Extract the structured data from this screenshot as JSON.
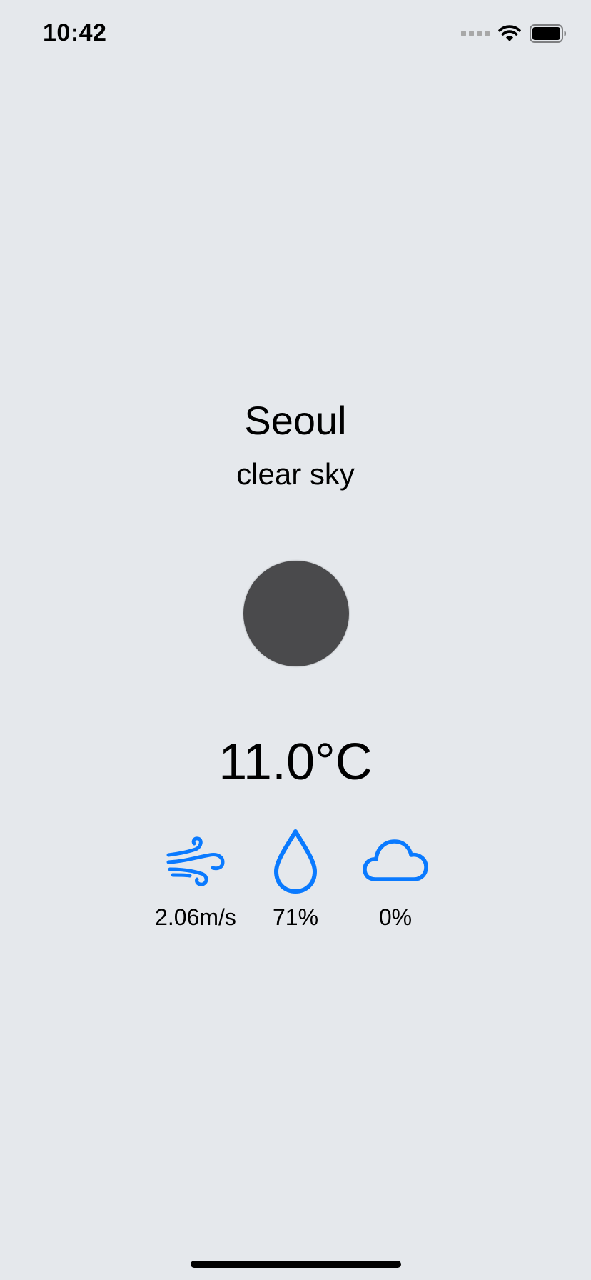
{
  "status_bar": {
    "time": "10:42",
    "icons": [
      "cellular-signal-icon",
      "wifi-icon",
      "battery-icon"
    ]
  },
  "weather": {
    "city": "Seoul",
    "description": "clear sky",
    "temperature": "11.0°C",
    "icon": "weather-icon-placeholder",
    "stats": {
      "wind": {
        "icon": "wind-icon",
        "value": "2.06m/s"
      },
      "humidity": {
        "icon": "humidity-drop-icon",
        "value": "71%"
      },
      "cloudiness": {
        "icon": "cloud-icon",
        "value": "0%"
      }
    }
  },
  "colors": {
    "background": "#e5e8ec",
    "accent": "#0a7aff",
    "image_placeholder": "#4a4a4c"
  }
}
